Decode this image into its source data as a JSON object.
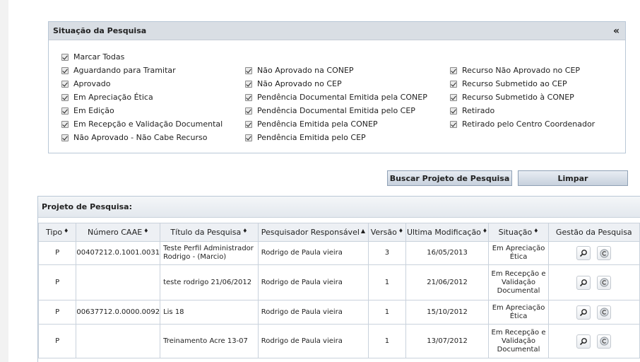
{
  "filter": {
    "title": "Situação da Pesquisa",
    "collapse_icon": "«",
    "col1": [
      "Marcar Todas",
      "Aguardando para Tramitar",
      "Aprovado",
      "Em Apreciação Ética",
      "Em Edição",
      "Em Recepção e Validação Documental",
      "Não Aprovado - Não Cabe Recurso"
    ],
    "col2": [
      "Não Aprovado na CONEP",
      "Não Aprovado no CEP",
      "Pendência Documental Emitida pela CONEP",
      "Pendência Documental Emitida pelo CEP",
      "Pendência Emitida pela CONEP",
      "Pendência Emitida pelo CEP"
    ],
    "col3": [
      "Recurso Não Aprovado no CEP",
      "Recurso Submetido ao CEP",
      "Recurso Submetido à CONEP",
      "Retirado",
      "Retirado pelo Centro Coordenador"
    ]
  },
  "buttons": {
    "search": "Buscar Projeto de Pesquisa",
    "clear": "Limpar"
  },
  "projects": {
    "title": "Projeto de Pesquisa:",
    "columns": {
      "tipo": "Tipo",
      "caae": "Número CAAE",
      "titulo": "Título da Pesquisa",
      "pesquisador": "Pesquisador Responsável",
      "versao": "Versão",
      "modificacao": "Ultima Modificação",
      "situacao": "Situação",
      "gestao": "Gestão da Pesquisa"
    },
    "sort_icon": "♦",
    "sort_up_icon": "▲",
    "rows": [
      {
        "tipo": "P",
        "caae": "00407212.0.1001.0031",
        "titulo": "Teste Perfil Administrador Rodrigo - (Marcio)",
        "pesquisador": "Rodrigo de Paula vieira",
        "versao": "3",
        "modificacao": "16/05/2013",
        "situacao": "Em Apreciação Ética"
      },
      {
        "tipo": "P",
        "caae": "",
        "titulo": "teste rodrigo 21/06/2012",
        "pesquisador": "Rodrigo de Paula vieira",
        "versao": "1",
        "modificacao": "21/06/2012",
        "situacao": "Em Recepção e Validação Documental"
      },
      {
        "tipo": "P",
        "caae": "00637712.0.0000.0092",
        "titulo": "Lis 18",
        "pesquisador": "Rodrigo de Paula vieira",
        "versao": "1",
        "modificacao": "15/10/2012",
        "situacao": "Em Apreciação Ética"
      },
      {
        "tipo": "P",
        "caae": "",
        "titulo": "Treinamento Acre 13-07",
        "pesquisador": "Rodrigo de Paula vieira",
        "versao": "1",
        "modificacao": "13/07/2012",
        "situacao": "Em Recepção e Validação Documental"
      }
    ]
  }
}
